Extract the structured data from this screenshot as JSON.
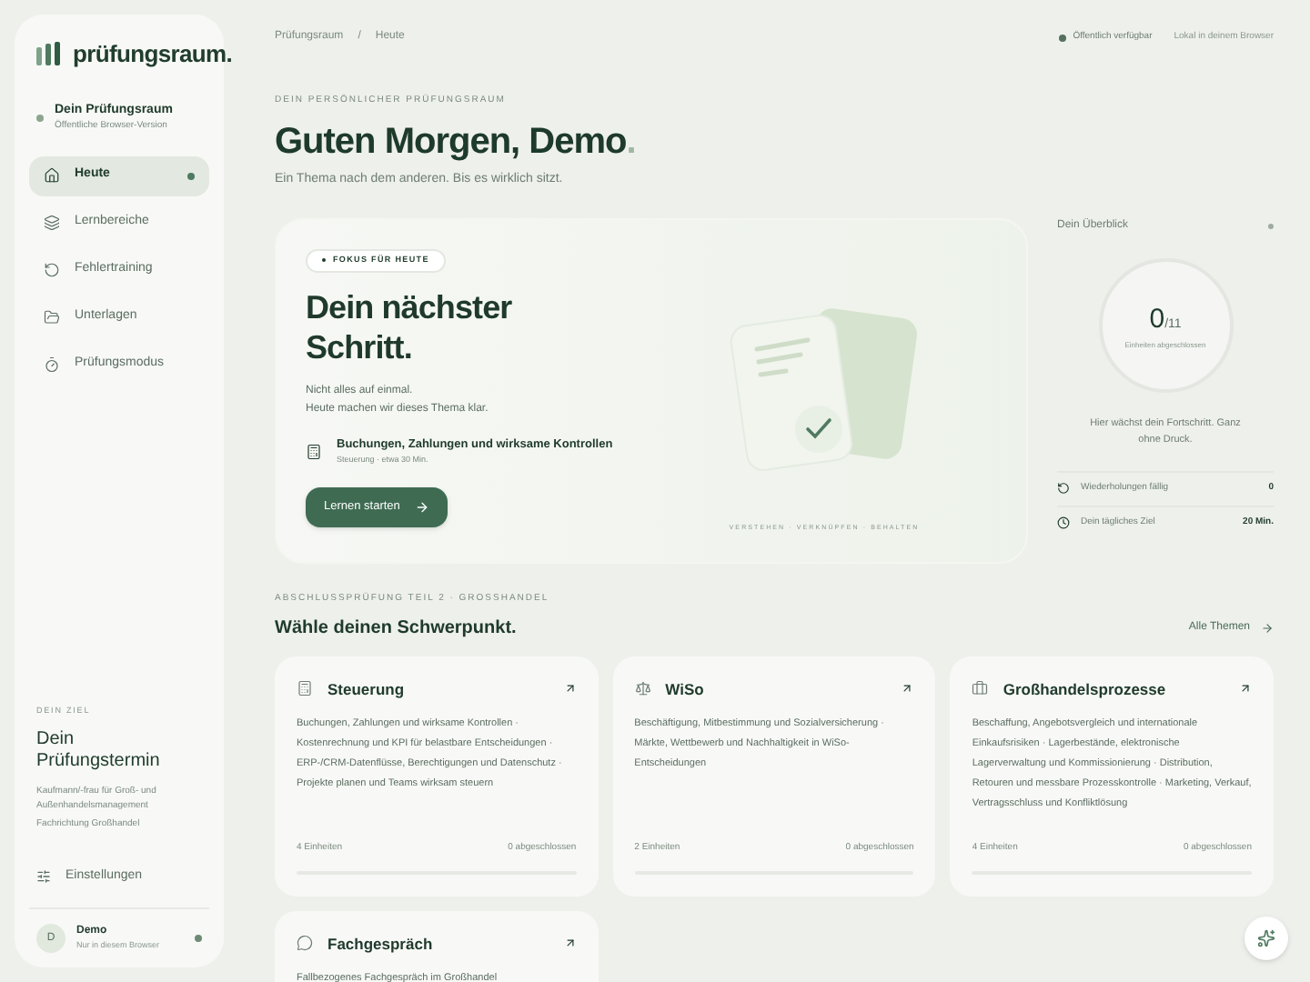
{
  "sidebar": {
    "brand": "prüfungsraum.",
    "space": {
      "title": "Dein Prüfungsraum",
      "subtitle": "Öffentliche Browser-Version"
    },
    "items": [
      {
        "label": "Heute",
        "selected": true
      },
      {
        "label": "Lernbereiche",
        "selected": false
      },
      {
        "label": "Fehlertraining",
        "selected": false
      },
      {
        "label": "Unterlagen",
        "selected": false
      },
      {
        "label": "Prüfungsmodus",
        "selected": false
      }
    ],
    "goal": {
      "eyebrow": "DEIN ZIEL",
      "title": "Dein Prüfungstermin",
      "lines": [
        "Kaufmann/-frau für Groß- und Außenhandelsmanagement",
        "Fachrichtung Großhandel"
      ]
    },
    "settings": "Einstellungen",
    "user": {
      "initial": "D",
      "name": "Demo",
      "subtitle": "Nur in diesem Browser"
    }
  },
  "breadcrumb": [
    "Prüfungsraum",
    "/",
    "Heute"
  ],
  "status": {
    "available": "Öffentlich verfügbar",
    "local": "Lokal in deinem Browser"
  },
  "header": {
    "eyebrow": "DEIN PERSÖNLICHER PRÜFUNGSRAUM",
    "title": "Guten Morgen, Demo",
    "title_end": ".",
    "subtitle": "Ein Thema nach dem anderen. Bis es wirklich sitzt."
  },
  "focus": {
    "badge": "FOKUS FÜR HEUTE",
    "title": "Dein nächster Schritt.",
    "text": [
      "Nicht alles auf einmal.",
      "Heute machen wir dieses Thema klar."
    ],
    "topic": "Buchungen, Zahlungen und wirksame Kontrollen",
    "topic_meta": "Steuerung · etwa 30 Min.",
    "button": "Lernen starten",
    "caption": "VERSTEHEN · VERKNÜPFEN · BEHALTEN"
  },
  "overview": {
    "title": "Dein Überblick",
    "count": "0",
    "total": "/11",
    "count_label": "Einheiten abgeschlossen",
    "note": "Hier wächst dein Fortschritt. Ganz ohne Druck.",
    "rows": [
      {
        "label": "Wiederholungen fällig",
        "value": "0"
      },
      {
        "label": "Dein tägliches Ziel",
        "value": "20 Min."
      }
    ]
  },
  "topics": {
    "eyebrow": "ABSCHLUSSPRÜFUNG TEIL 2 · GROSSHANDEL",
    "title": "Wähle deinen Schwerpunkt.",
    "link": "Alle Themen",
    "cards": [
      {
        "title": "Steuerung",
        "text": "Buchungen, Zahlungen und wirksame Kontrollen · Kostenrechnung und KPI für belastbare Entscheidungen · ERP-/CRM-Datenflüsse, Berechtigungen und Datenschutz · Projekte planen und Teams wirksam steuern",
        "units": "4 Einheiten",
        "done": "0 abgeschlossen"
      },
      {
        "title": "WiSo",
        "text": "Beschäftigung, Mitbestimmung und Sozialversicherung · Märkte, Wettbewerb und Nachhaltigkeit in WiSo-Entscheidungen",
        "units": "2 Einheiten",
        "done": "0 abgeschlossen"
      },
      {
        "title": "Großhandelsprozesse",
        "text": "Beschaffung, Angebotsvergleich und internationale Einkaufsrisiken · Lagerbestände, elektronische Lagerverwaltung und Kommissionierung · Distribution, Retouren und messbare Prozesskontrolle · Marketing, Verkauf, Vertragsschluss und Konfliktlösung",
        "units": "4 Einheiten",
        "done": "0 abgeschlossen"
      },
      {
        "title": "Fachgespräch",
        "text": "Fallbezogenes Fachgespräch im Großhandel"
      }
    ]
  }
}
